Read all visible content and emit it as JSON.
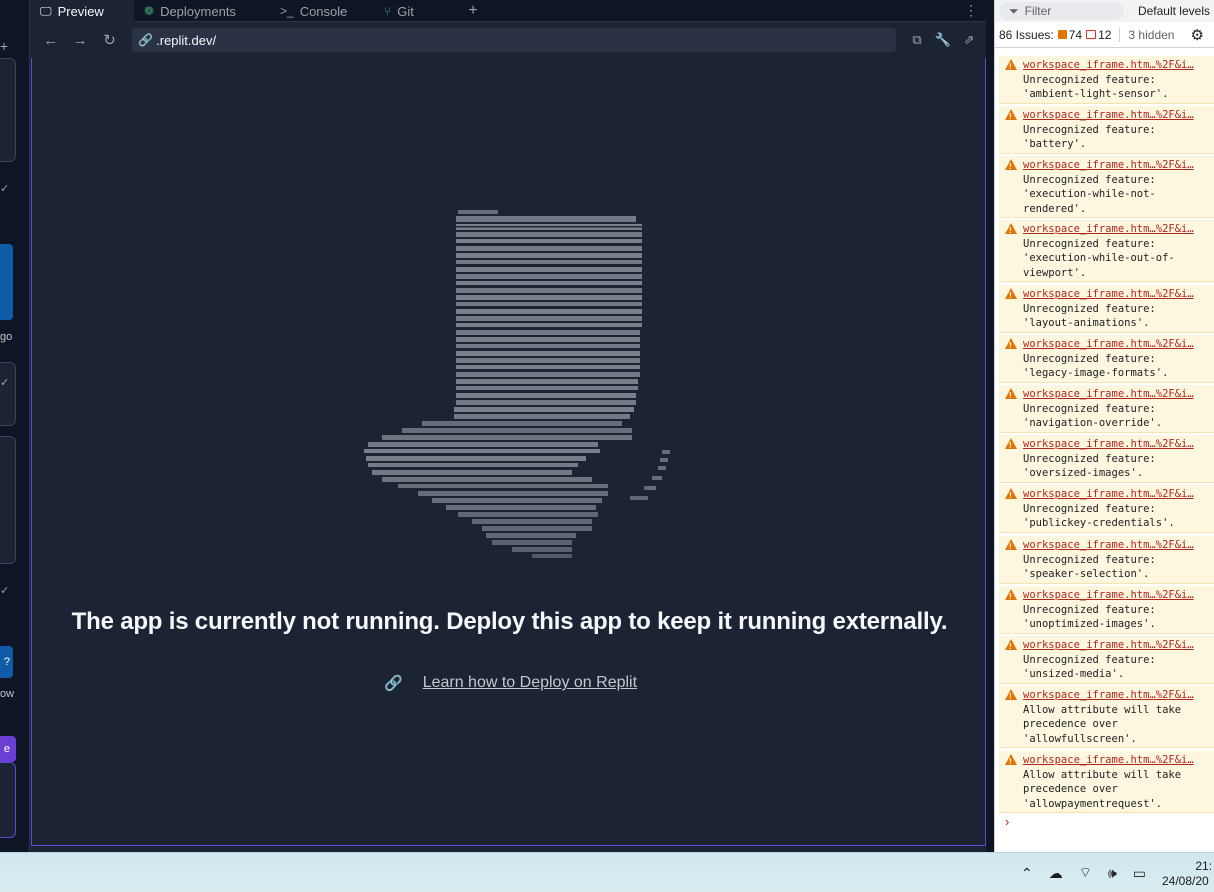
{
  "tabs": [
    {
      "label": "Preview",
      "icon": "monitor-icon",
      "active": true
    },
    {
      "label": "Deployments",
      "icon": "deployments-icon",
      "active": false
    },
    {
      "label": "Console",
      "icon": "terminal-icon",
      "active": false
    },
    {
      "label": "Git",
      "icon": "git-icon",
      "active": false
    }
  ],
  "address": {
    "url": ".replit.dev/"
  },
  "preview": {
    "message": "The app is currently not running. Deploy this app to keep it running externally.",
    "learn_link": "Learn how to Deploy on Replit"
  },
  "left_strip": {
    "label_1": "go",
    "label_2": "ow",
    "label_3": "e",
    "badge_q": "?"
  },
  "devtools": {
    "filter_placeholder": "Filter",
    "levels_label": "Default levels",
    "issues_label": "86 Issues:",
    "warning_count": "74",
    "info_count": "12",
    "hidden_label": "3 hidden",
    "source": "workspace_iframe.htm…%2F&i…",
    "issues": [
      {
        "msg": "Unrecognized feature:\n'ambient-light-sensor'."
      },
      {
        "msg": "Unrecognized feature:\n'battery'."
      },
      {
        "msg": "Unrecognized feature:\n'execution-while-not-\nrendered'."
      },
      {
        "msg": "Unrecognized feature:\n'execution-while-out-of-\nviewport'."
      },
      {
        "msg": "Unrecognized feature:\n'layout-animations'."
      },
      {
        "msg": "Unrecognized feature:\n'legacy-image-formats'."
      },
      {
        "msg": "Unrecognized feature:\n'navigation-override'."
      },
      {
        "msg": "Unrecognized feature:\n'oversized-images'."
      },
      {
        "msg": "Unrecognized feature:\n'publickey-credentials'."
      },
      {
        "msg": "Unrecognized feature:\n'speaker-selection'."
      },
      {
        "msg": "Unrecognized feature:\n'unoptimized-images'."
      },
      {
        "msg": "Unrecognized feature:\n'unsized-media'."
      },
      {
        "msg": "Allow attribute will take\nprecedence over\n'allowfullscreen'."
      },
      {
        "msg": "Allow attribute will take\nprecedence over\n'allowpaymentrequest'."
      }
    ],
    "prompt": "›"
  },
  "taskbar": {
    "time": "21:",
    "date": "24/08/20"
  },
  "colors": {
    "preview_bg": "#1c2333",
    "accent_border": "#5b4ed6",
    "warning": "#e37400",
    "issue_bg": "#fef7e0"
  }
}
